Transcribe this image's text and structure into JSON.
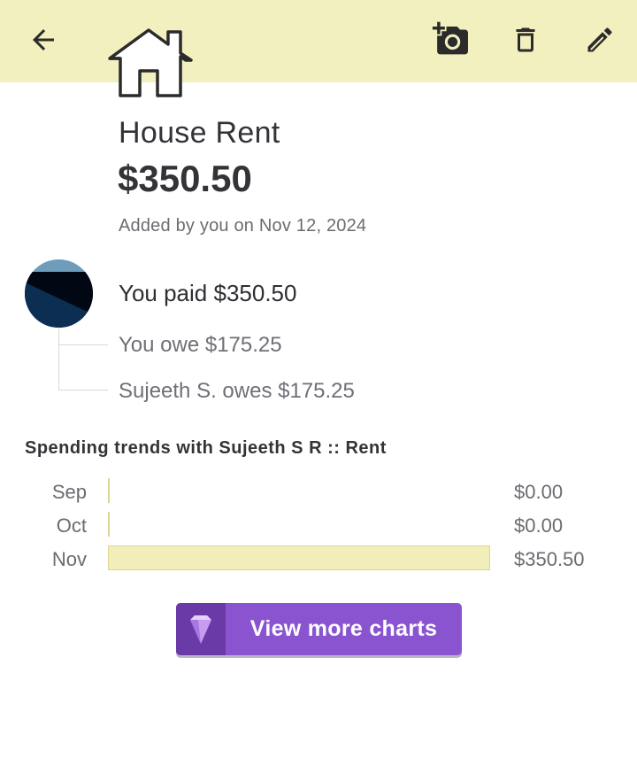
{
  "toolbar": {
    "back_icon": "arrow-left-icon",
    "camera_icon": "add-photo-icon",
    "delete_icon": "trash-icon",
    "edit_icon": "pencil-icon"
  },
  "expense": {
    "category_icon": "house-icon",
    "title": "House Rent",
    "amount": "$350.50",
    "added_by": "Added by you on Nov 12, 2024"
  },
  "split": {
    "paid": "You paid $350.50",
    "owes": [
      "You owe $175.25",
      "Sujeeth S. owes $175.25"
    ]
  },
  "trends": {
    "title": "Spending trends with Sujeeth S R :: Rent",
    "button_label": "View more charts",
    "button_icon": "gem-icon"
  },
  "chart_data": {
    "type": "bar",
    "orientation": "horizontal",
    "categories": [
      "Sep",
      "Oct",
      "Nov"
    ],
    "values": [
      0.0,
      0.0,
      350.5
    ],
    "value_labels": [
      "$0.00",
      "$0.00",
      "$350.50"
    ]
  },
  "colors": {
    "header_bg": "#f3f0c0",
    "bar_fill": "#f1eeb9",
    "button_bg": "#8a54d0",
    "button_icon_bg": "#6a3aa6"
  }
}
